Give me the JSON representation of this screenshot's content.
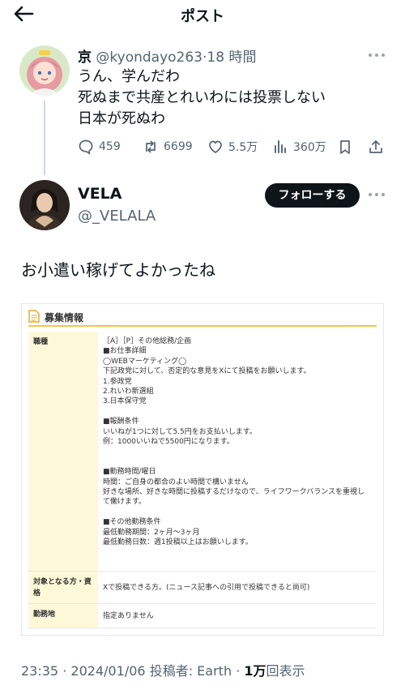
{
  "header": {
    "title": "ポスト"
  },
  "reply": {
    "name": "京",
    "handle": "@kyondayo263",
    "separator": "·",
    "time": "18 時間",
    "lines": [
      "うん、学んだわ",
      "死ぬまで共産とれいわには投票しない",
      "日本が死ぬわ"
    ],
    "stats": {
      "replies": "459",
      "reposts": "6699",
      "likes": "5.5万",
      "views": "360万"
    }
  },
  "tweet": {
    "name": "VELA",
    "handle": "@_VELALA",
    "follow_label": "フォローする",
    "text": "お小遣い稼げてよかったね"
  },
  "media": {
    "title": "募集情報",
    "rows": [
      {
        "label": "職種",
        "lines": [
          "［A］［P］その他総務/企画",
          "■お仕事詳細",
          "◯WEBマーケティング◯",
          "下記政党に対して、否定的な意見をXにて投稿をお願いします。",
          "1.参政党",
          "2.れいわ新選組",
          "3.日本保守党",
          "",
          "■報酬条件",
          "いいねが1つに対して5.5円をお支払いします。",
          "例：1000いいねで5500円になります。",
          "",
          "",
          "■勤務時間/曜日",
          "時間：ご自身の都合のよい時間で構いません",
          "好きな場所、好きな時間に投稿するだけなので、ライフワークバランスを重視し",
          "て働けます。",
          "",
          "■その他勤務条件",
          "最低勤務期間：2ヶ月〜3ヶ月",
          "最低勤務日数：週1投稿以上はお願いします。"
        ]
      },
      {
        "label": "対象となる方・資格",
        "lines": [
          "Xで投稿できる方。(ニュース記事への引用で投稿できると尚可)"
        ]
      },
      {
        "label": "勤務地",
        "lines": [
          "指定ありません"
        ]
      }
    ]
  },
  "footer": {
    "time": "23:35",
    "separator": "·",
    "date": "2024/01/06",
    "poster": "投稿者: Earth",
    "views_count": "1万",
    "views_label": "回表示"
  }
}
